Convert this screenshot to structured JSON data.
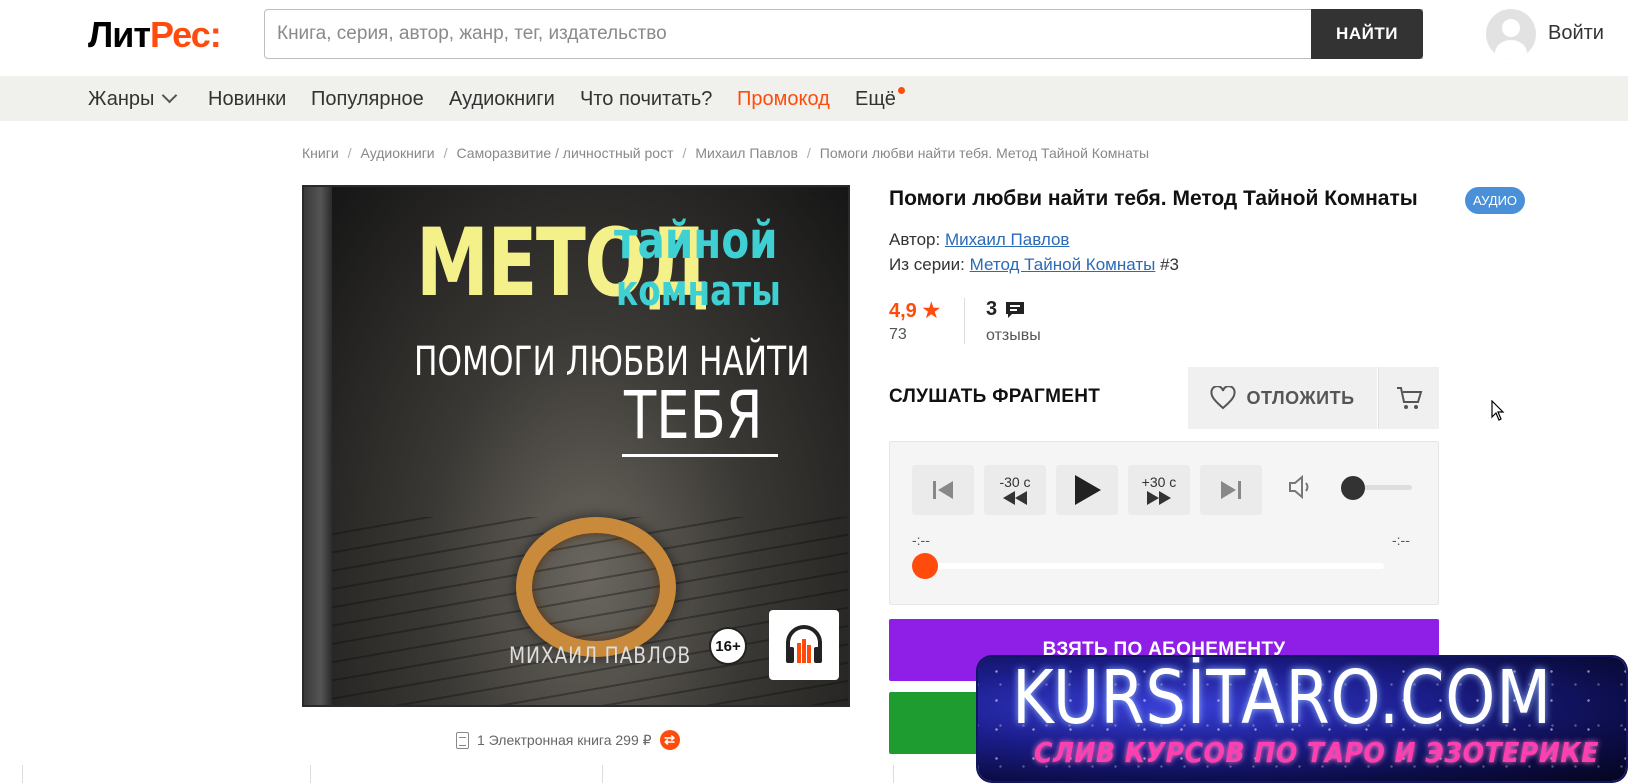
{
  "header": {
    "logo_part1": "Лит",
    "logo_part2": "Рес:",
    "search_placeholder": "Книга, серия, автор, жанр, тег, издательство",
    "search_button": "НАЙТИ",
    "login": "Войти"
  },
  "nav": {
    "items": [
      {
        "label": "Жанры"
      },
      {
        "label": "Новинки"
      },
      {
        "label": "Популярное"
      },
      {
        "label": "Аудиокниги"
      },
      {
        "label": "Что почитать?"
      },
      {
        "label": "Промокод"
      },
      {
        "label": "Ещё"
      }
    ]
  },
  "breadcrumbs": [
    "Книги",
    "Аудиокниги",
    "Саморазвитие / личностный рост",
    "Михаил Павлов",
    "Помоги любви найти тебя. Метод Тайной Комнаты"
  ],
  "cover": {
    "line1": "МЕТОД",
    "line2": "тайной",
    "line3": "комнаты",
    "line4": "ПОМОГИ ЛЮБВИ НАЙТИ",
    "line5": "ТЕБЯ",
    "author": "МИХАИЛ ПАВЛОВ",
    "age": "16+",
    "info": "1 Электронная книга 299 ₽"
  },
  "book": {
    "title": "Помоги любви найти тебя. Метод Тайной Комнаты",
    "type_badge": "АУДИО",
    "author_label": "Автор:",
    "author": "Михаил Павлов",
    "series_label": "Из серии:",
    "series": "Метод Тайной Комнаты",
    "series_num": "#3",
    "rating": "4,9",
    "rating_count": "73",
    "reviews": "3",
    "reviews_label": "отзывы"
  },
  "actions": {
    "listen": "СЛУШАТЬ ФРАГМЕНТ",
    "defer": "ОТЛОЖИТЬ",
    "subscribe": "ВЗЯТЬ ПО АБОНЕМЕНТУ"
  },
  "player": {
    "back_label": "-30 с",
    "fwd_label": "+30 с",
    "time_current": "-:--",
    "time_total": "-:--",
    "volume": 0,
    "progress": 0
  },
  "watermark": {
    "title": "KURSİTARO.COM",
    "subtitle": "СЛИВ КУРСОВ ПО ТАРО И ЭЗОТЕРИКЕ"
  },
  "colors": {
    "accent": "#ff4c0c",
    "subscribe": "#8f1fe6",
    "buy": "#1f9c2f",
    "link": "#2a6ab8",
    "badge": "#4a90d9"
  }
}
